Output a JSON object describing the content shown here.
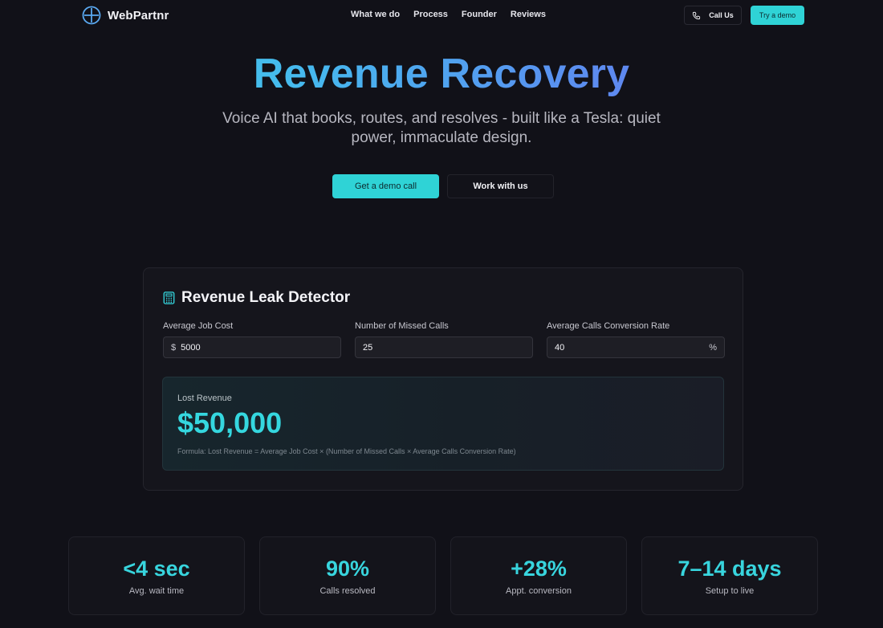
{
  "nav": {
    "brand": "WebPartnr",
    "links": [
      "What we do",
      "Process",
      "Founder",
      "Reviews"
    ],
    "call_label": "Call Us",
    "demo_label": "Try a demo"
  },
  "hero": {
    "title": "Revenue Recovery",
    "subtitle": "Voice AI that books, routes, and resolves - built like a Tesla: quiet power, immaculate design.",
    "primary_cta": "Get a demo call",
    "secondary_cta": "Work with us"
  },
  "calculator": {
    "title": "Revenue Leak Detector",
    "fields": [
      {
        "label": "Average Job Cost",
        "prefix": "$",
        "value": "5000",
        "suffix": ""
      },
      {
        "label": "Number of Missed Calls",
        "prefix": "",
        "value": "25",
        "suffix": ""
      },
      {
        "label": "Average Calls Conversion Rate",
        "prefix": "",
        "value": "40",
        "suffix": "%"
      }
    ],
    "result_label": "Lost Revenue",
    "result_value": "$50,000",
    "formula": "Formula: Lost Revenue = Average Job Cost × (Number of Missed Calls × Average Calls Conversion Rate)"
  },
  "stats": [
    {
      "value": "<4 sec",
      "label": "Avg. wait time"
    },
    {
      "value": "90%",
      "label": "Calls resolved"
    },
    {
      "value": "+28%",
      "label": "Appt. conversion"
    },
    {
      "value": "7–14 days",
      "label": "Setup to live"
    }
  ],
  "colors": {
    "background": "#111118",
    "accent": "#2fd3d6",
    "gradient_start": "#3fd6e3",
    "gradient_end": "#7468ec"
  },
  "icons": {
    "brand": "crosshair-circle-icon",
    "call": "phone-icon",
    "calculator": "calculator-icon"
  }
}
